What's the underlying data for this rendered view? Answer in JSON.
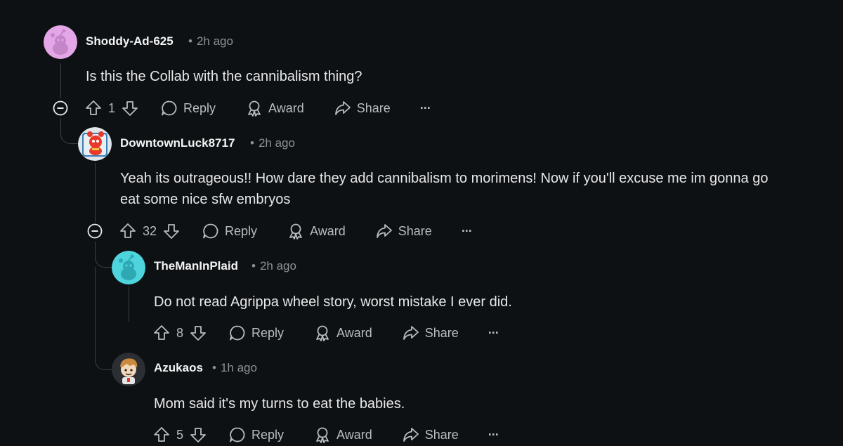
{
  "comments": [
    {
      "author": "Shoddy-Ad-625",
      "time": "2h ago",
      "text": "Is this the Collab with the cannibalism thing?",
      "votes": "1",
      "reply_label": "Reply",
      "award_label": "Award",
      "share_label": "Share",
      "more_label": "···",
      "avatar_color": "#e5a6e8"
    },
    {
      "author": "DowntownLuck8717",
      "time": "2h ago",
      "text_line1": "Yeah its outrageous!! How dare they add cannibalism to morimens! Now if you'll excuse me im gonna go",
      "text_line2": "eat some nice sfw embryos",
      "votes": "32",
      "reply_label": "Reply",
      "award_label": "Award",
      "share_label": "Share",
      "more_label": "···",
      "avatar_color": "#ff4500"
    },
    {
      "author": "TheManInPlaid",
      "time": "2h ago",
      "text": "Do not read Agrippa wheel story, worst mistake I ever did.",
      "votes": "8",
      "reply_label": "Reply",
      "award_label": "Award",
      "share_label": "Share",
      "more_label": "···",
      "avatar_color": "#4dd4dc"
    },
    {
      "author": "Azukaos",
      "time": "1h ago",
      "text": "Mom said it's my turns to eat the babies.",
      "votes": "5",
      "reply_label": "Reply",
      "award_label": "Award",
      "share_label": "Share",
      "more_label": "···",
      "avatar_color": "#2b2f33"
    }
  ],
  "separator": "•"
}
